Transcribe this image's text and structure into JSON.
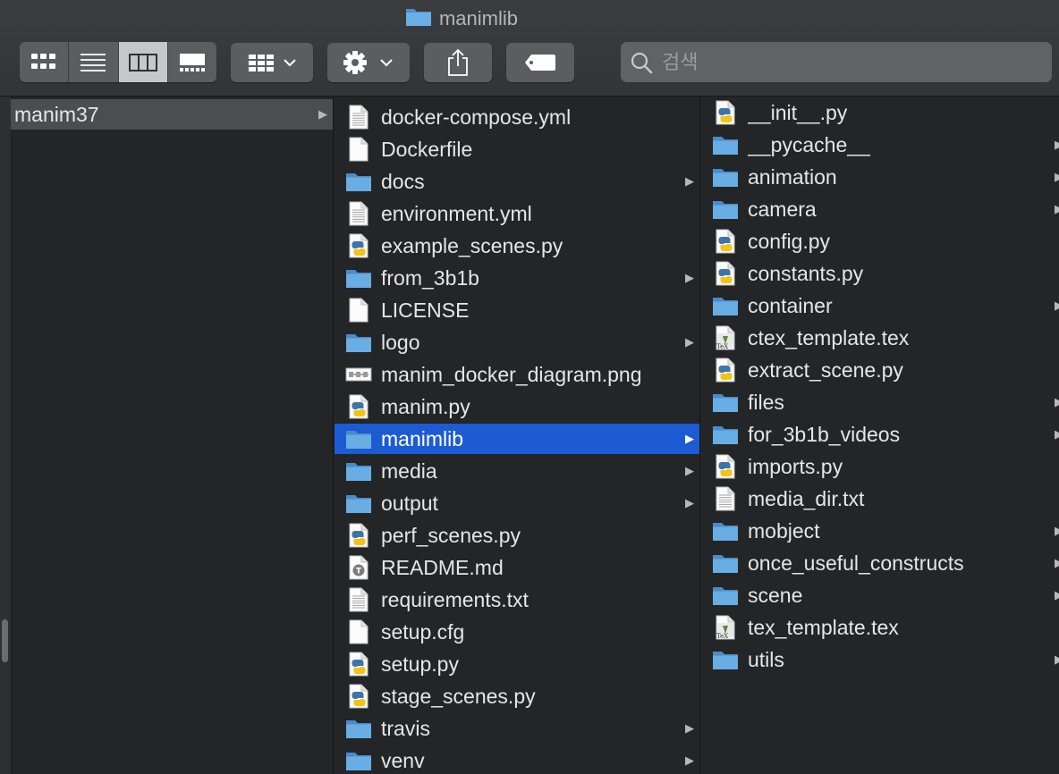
{
  "window": {
    "title": "manimlib"
  },
  "toolbar": {
    "view_buttons": [
      {
        "name": "icon-view-button",
        "icon": "grid-icon"
      },
      {
        "name": "list-view-button",
        "icon": "list-icon"
      },
      {
        "name": "column-view-button",
        "icon": "columns-icon",
        "active": true
      },
      {
        "name": "gallery-view-button",
        "icon": "gallery-icon"
      }
    ],
    "group_button": {
      "icon": "group-grid-icon"
    },
    "action_button": {
      "icon": "gear-icon"
    },
    "share_button": {
      "icon": "share-icon"
    },
    "tag_button": {
      "icon": "tag-icon"
    },
    "search": {
      "placeholder": "검색",
      "value": ""
    }
  },
  "columns": {
    "col1": [
      {
        "name": "manim37",
        "kind": "folder",
        "chevron": true,
        "selected": "gray"
      }
    ],
    "col2": [
      {
        "name": "docker-compose.yml",
        "kind": "text"
      },
      {
        "name": "Dockerfile",
        "kind": "blank"
      },
      {
        "name": "docs",
        "kind": "folder",
        "chevron": true
      },
      {
        "name": "environment.yml",
        "kind": "text"
      },
      {
        "name": "example_scenes.py",
        "kind": "python"
      },
      {
        "name": "from_3b1b",
        "kind": "folder",
        "chevron": true
      },
      {
        "name": "LICENSE",
        "kind": "blank"
      },
      {
        "name": "logo",
        "kind": "folder",
        "chevron": true
      },
      {
        "name": "manim_docker_diagram.png",
        "kind": "image"
      },
      {
        "name": "manim.py",
        "kind": "python"
      },
      {
        "name": "manimlib",
        "kind": "folder",
        "chevron": true,
        "selected": "blue"
      },
      {
        "name": "media",
        "kind": "folder",
        "chevron": true
      },
      {
        "name": "output",
        "kind": "folder",
        "chevron": true
      },
      {
        "name": "perf_scenes.py",
        "kind": "python"
      },
      {
        "name": "README.md",
        "kind": "markdown"
      },
      {
        "name": "requirements.txt",
        "kind": "text"
      },
      {
        "name": "setup.cfg",
        "kind": "blank"
      },
      {
        "name": "setup.py",
        "kind": "python"
      },
      {
        "name": "stage_scenes.py",
        "kind": "python"
      },
      {
        "name": "travis",
        "kind": "folder",
        "chevron": true
      },
      {
        "name": "venv",
        "kind": "folder",
        "chevron": true
      }
    ],
    "col3": [
      {
        "name": "__init__.py",
        "kind": "python"
      },
      {
        "name": "__pycache__",
        "kind": "folder",
        "chevron": true
      },
      {
        "name": "animation",
        "kind": "folder",
        "chevron": true
      },
      {
        "name": "camera",
        "kind": "folder",
        "chevron": true
      },
      {
        "name": "config.py",
        "kind": "python"
      },
      {
        "name": "constants.py",
        "kind": "python"
      },
      {
        "name": "container",
        "kind": "folder",
        "chevron": true
      },
      {
        "name": "ctex_template.tex",
        "kind": "tex"
      },
      {
        "name": "extract_scene.py",
        "kind": "python"
      },
      {
        "name": "files",
        "kind": "folder",
        "chevron": true
      },
      {
        "name": "for_3b1b_videos",
        "kind": "folder",
        "chevron": true
      },
      {
        "name": "imports.py",
        "kind": "python"
      },
      {
        "name": "media_dir.txt",
        "kind": "text"
      },
      {
        "name": "mobject",
        "kind": "folder",
        "chevron": true
      },
      {
        "name": "once_useful_constructs",
        "kind": "folder",
        "chevron": true
      },
      {
        "name": "scene",
        "kind": "folder",
        "chevron": true
      },
      {
        "name": "tex_template.tex",
        "kind": "tex"
      },
      {
        "name": "utils",
        "kind": "folder",
        "chevron": true
      }
    ]
  },
  "colors": {
    "background": "#232527",
    "toolbar": "#37393c",
    "selection_blue": "#1d5bd3",
    "selection_gray": "#4b4d50",
    "folder": "#5ea2db"
  }
}
